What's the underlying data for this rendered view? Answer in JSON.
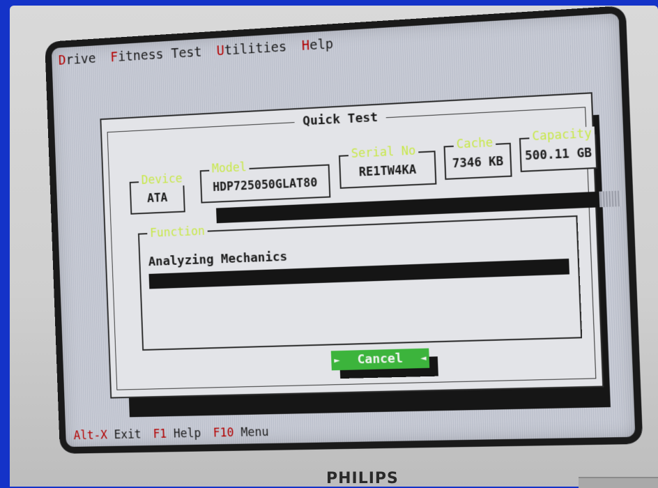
{
  "menu": [
    {
      "hot": "D",
      "rest": "rive"
    },
    {
      "hot": "F",
      "rest": "itness Test"
    },
    {
      "hot": "U",
      "rest": "tilities"
    },
    {
      "hot": "H",
      "rest": "elp"
    }
  ],
  "dialog": {
    "title": "Quick Test",
    "device": {
      "label": "Device",
      "value": "ATA"
    },
    "model": {
      "label": "Model",
      "value": "HDP725050GLAT80"
    },
    "serial": {
      "label": "Serial No",
      "value": "RE1TW4KA"
    },
    "cache": {
      "label": "Cache",
      "value": "7346 KB"
    },
    "capacity": {
      "label": "Capacity",
      "value": "500.11 GB"
    },
    "function": {
      "label": "Function",
      "value": "Analyzing Mechanics"
    },
    "overall_progress_pct": 95,
    "function_progress_pct": 100,
    "cancel_label": "Cancel",
    "cancel_arrow_left": "►",
    "cancel_arrow_right": "◄"
  },
  "status": [
    {
      "hot": "Alt-X",
      "rest": " Exit"
    },
    {
      "hot": "F1",
      "rest": " Help"
    },
    {
      "hot": "F10",
      "rest": " Menu"
    }
  ],
  "brand": "PHILIPS",
  "colors": {
    "hotkey": "#b30000",
    "label_accent": "#c8e84a",
    "button_green": "#3cb43c",
    "background_blue": "#1433c8"
  }
}
